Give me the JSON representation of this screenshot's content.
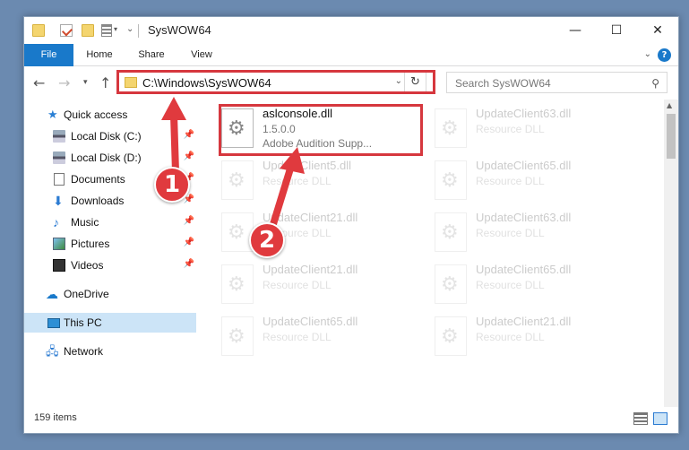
{
  "window": {
    "title": "SysWOW64"
  },
  "ribbon": {
    "tabs": [
      "File",
      "Home",
      "Share",
      "View"
    ],
    "help": "?"
  },
  "navigation": {
    "address": "C:\\Windows\\SysWOW64",
    "search_placeholder": "Search SysWOW64"
  },
  "sidebar": {
    "items": [
      {
        "label": "Quick access",
        "icon": "star-icon"
      },
      {
        "label": "Local Disk (C:)",
        "icon": "disk-icon",
        "pinned": true
      },
      {
        "label": "Local Disk (D:)",
        "icon": "disk-icon",
        "pinned": true
      },
      {
        "label": "Documents",
        "icon": "documents-icon",
        "pinned": true
      },
      {
        "label": "Downloads",
        "icon": "download-icon",
        "pinned": true
      },
      {
        "label": "Music",
        "icon": "music-icon",
        "pinned": true
      },
      {
        "label": "Pictures",
        "icon": "pictures-icon",
        "pinned": true
      },
      {
        "label": "Videos",
        "icon": "videos-icon",
        "pinned": true
      },
      {
        "label": "OneDrive",
        "icon": "cloud-icon"
      },
      {
        "label": "This PC",
        "icon": "pc-icon",
        "selected": true
      },
      {
        "label": "Network",
        "icon": "network-icon"
      }
    ]
  },
  "files": {
    "highlighted": {
      "name": "aslconsole.dll",
      "version": "1.5.0.0",
      "description": "Adobe Audition Supp..."
    },
    "faded": [
      {
        "name": "UpdateClient63.dll",
        "description": "Resource DLL"
      },
      {
        "name": "UpdateClient5.dll",
        "description": "Resource DLL"
      },
      {
        "name": "UpdateClient65.dll",
        "description": "Resource DLL"
      },
      {
        "name": "UpdateClient21.dll",
        "description": "Resource DLL"
      },
      {
        "name": "UpdateClient63.dll",
        "description": "Resource DLL"
      },
      {
        "name": "UpdateClient21.dll",
        "description": "Resource DLL"
      },
      {
        "name": "UpdateClient65.dll",
        "description": "Resource DLL"
      },
      {
        "name": "UpdateClient65.dll",
        "description": "Resource DLL"
      },
      {
        "name": "UpdateClient21.dll",
        "description": "Resource DLL"
      }
    ]
  },
  "status": {
    "item_count": "159 items"
  },
  "annotations": {
    "callout_1": "1",
    "callout_2": "2",
    "color": "#e03a3e"
  }
}
